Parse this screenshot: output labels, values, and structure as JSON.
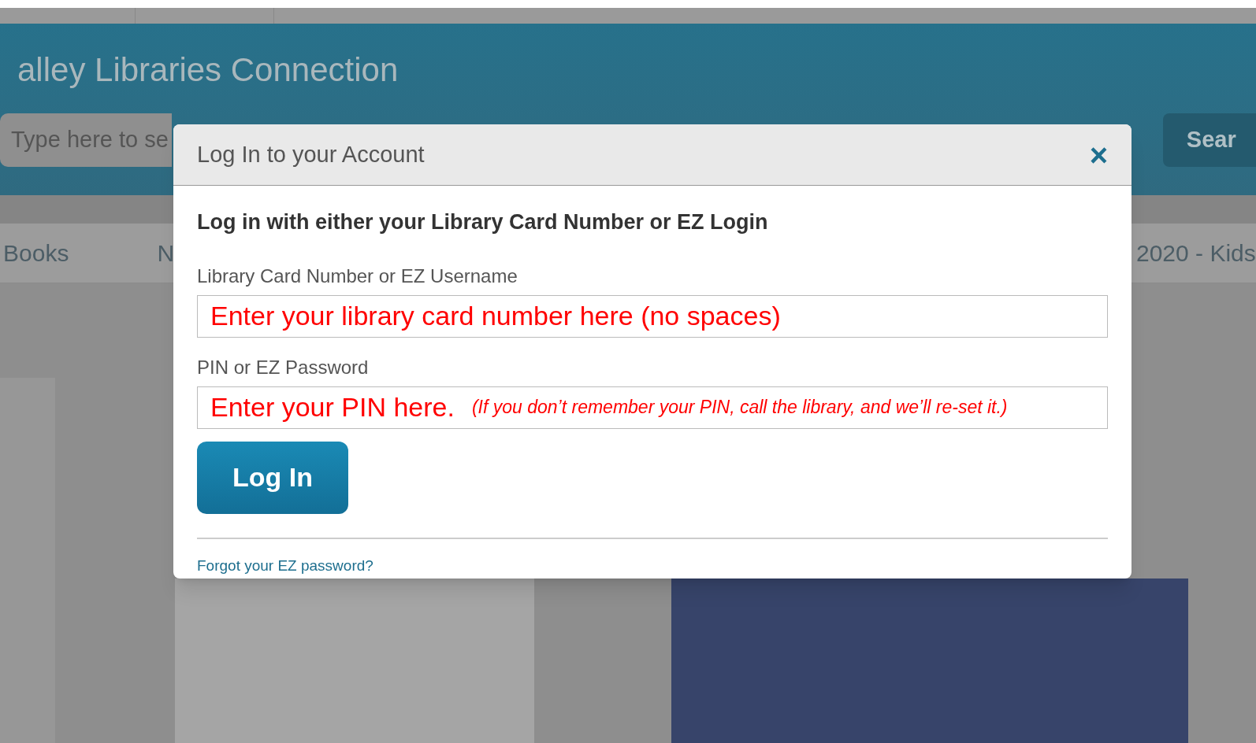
{
  "header": {
    "title": "alley Libraries Connection",
    "search": {
      "placeholder": "Type here to se"
    },
    "search_button": "Sear"
  },
  "nav": [
    "Books",
    "N",
    "2020 - Kids"
  ],
  "dialog": {
    "title": "Log In to your Account",
    "close": "×",
    "heading": "Log in with either your Library Card Number or EZ Login",
    "fields": [
      {
        "label": "Library Card Number or EZ Username",
        "value": "Enter your library card number here (no spaces)"
      },
      {
        "label": "PIN or EZ Password",
        "value": "Enter your PIN here.",
        "note": "(If you don’t remember your PIN, call the library, and we’ll re-set it.)"
      }
    ],
    "button": "Log In",
    "link": "Forgot your EZ password?"
  }
}
